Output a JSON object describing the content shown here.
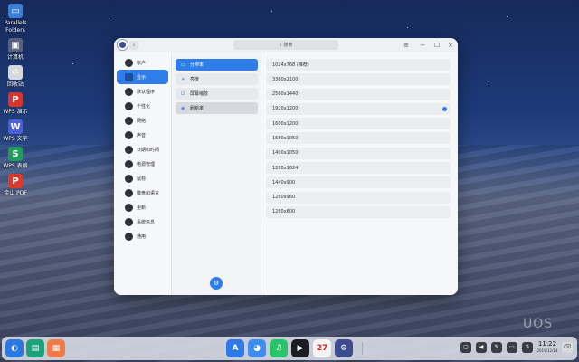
{
  "desktop": {
    "icons": [
      {
        "label": "Parallels Folders",
        "icon": "folder-icon",
        "color": "#3b7ed6"
      },
      {
        "label": "计算机",
        "icon": "computer-icon",
        "color": "#5a5f7a"
      },
      {
        "label": "回收站",
        "icon": "trash-icon",
        "color": "#d6d8dc"
      },
      {
        "label": "WPS 演示",
        "icon": "wps-presentation-icon",
        "color": "#d9342b"
      },
      {
        "label": "WPS 文字",
        "icon": "wps-writer-icon",
        "color": "#4a5fd9"
      },
      {
        "label": "WPS 表格",
        "icon": "wps-spreadsheet-icon",
        "color": "#1e9e5a"
      },
      {
        "label": "金山 PDF",
        "icon": "pdf-icon",
        "color": "#d93a2b"
      }
    ]
  },
  "window": {
    "search_placeholder": "搜索",
    "back_glyph": "‹",
    "controls": {
      "menu": "≡",
      "minimize": "−",
      "maximize": "☐",
      "close": "×"
    },
    "nav_items": [
      {
        "label": "帐户",
        "icon": "account-icon"
      },
      {
        "label": "显示",
        "icon": "display-icon",
        "active": true
      },
      {
        "label": "默认程序",
        "icon": "default-apps-icon"
      },
      {
        "label": "个性化",
        "icon": "personalization-icon"
      },
      {
        "label": "网络",
        "icon": "network-icon"
      },
      {
        "label": "声音",
        "icon": "sound-icon"
      },
      {
        "label": "日期和时间",
        "icon": "clock-icon"
      },
      {
        "label": "电源管理",
        "icon": "power-icon"
      },
      {
        "label": "鼠标",
        "icon": "mouse-icon"
      },
      {
        "label": "键盘和语言",
        "icon": "keyboard-icon"
      },
      {
        "label": "更新",
        "icon": "update-icon"
      },
      {
        "label": "系统信息",
        "icon": "system-info-icon"
      },
      {
        "label": "通用",
        "icon": "general-icon"
      }
    ],
    "sub_items": [
      {
        "label": "分辨率",
        "icon": "resolution-icon",
        "glyph": "▭",
        "state": "active"
      },
      {
        "label": "亮度",
        "icon": "brightness-icon",
        "glyph": "☀",
        "state": "normal"
      },
      {
        "label": "屏幕缩放",
        "icon": "scaling-icon",
        "glyph": "⊡",
        "state": "normal"
      },
      {
        "label": "刷新率",
        "icon": "refresh-rate-icon",
        "glyph": "◉",
        "state": "pale"
      }
    ],
    "round_button_glyph": "⚙",
    "resolutions": [
      {
        "label": "1024x768 (推荐)",
        "selected": false
      },
      {
        "label": "3360x2100",
        "selected": false
      },
      {
        "label": "2560x1440",
        "selected": false
      },
      {
        "label": "1920x1200",
        "selected": true
      },
      {
        "label": "1600x1200",
        "selected": false
      },
      {
        "label": "1680x1050",
        "selected": false
      },
      {
        "label": "1400x1050",
        "selected": false
      },
      {
        "label": "1280x1024",
        "selected": false
      },
      {
        "label": "1440x900",
        "selected": false
      },
      {
        "label": "1280x960",
        "selected": false
      },
      {
        "label": "1280x800",
        "selected": false
      }
    ]
  },
  "watermark": "UOS",
  "dock": {
    "left_apps": [
      {
        "icon": "launcher-icon",
        "color": "#2a78e0",
        "glyph": "◐"
      },
      {
        "icon": "multitask-icon",
        "color": "#1aa37a",
        "glyph": "▤"
      },
      {
        "icon": "workspace-icon",
        "color": "#f07a4a",
        "glyph": "▦"
      }
    ],
    "center_apps": [
      {
        "icon": "app-store-icon",
        "color": "#2b7ae8",
        "glyph": "A"
      },
      {
        "icon": "browser-icon",
        "color": "#3c8ff0",
        "glyph": "◕"
      },
      {
        "icon": "music-icon",
        "color": "#29c46a",
        "glyph": "♫"
      },
      {
        "icon": "video-player-icon",
        "color": "#1c1d22",
        "glyph": "▶"
      },
      {
        "icon": "calendar-icon",
        "color": "#f4f4f4",
        "glyph": "27"
      },
      {
        "icon": "control-center-icon",
        "color": "#3d4c8f",
        "glyph": "⚙"
      }
    ],
    "tray": [
      {
        "icon": "notification-icon",
        "glyph": "▢"
      },
      {
        "icon": "volume-icon",
        "glyph": "◀"
      },
      {
        "icon": "pen-icon",
        "glyph": "✎"
      },
      {
        "icon": "battery-icon",
        "glyph": "▭"
      },
      {
        "icon": "network-tray-icon",
        "glyph": "⇅"
      }
    ],
    "clock_time": "11:22",
    "clock_date": "2019/12/14",
    "trash_glyph": "⌫"
  }
}
